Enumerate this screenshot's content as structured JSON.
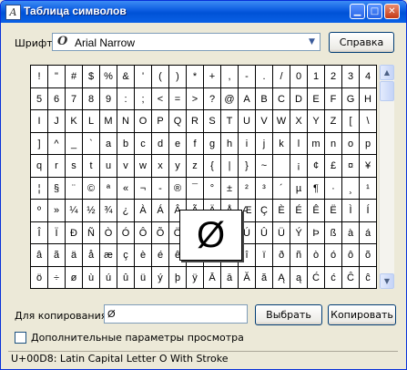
{
  "window": {
    "title": "Таблица символов"
  },
  "font": {
    "label": "Шрифт:",
    "value": "Arial Narrow"
  },
  "buttons": {
    "help": "Справка",
    "select": "Выбрать",
    "copy": "Копировать"
  },
  "copy": {
    "label": "Для копирования:",
    "value": "Ø"
  },
  "advanced": {
    "label": "Дополнительные параметры просмотра",
    "checked": false
  },
  "status": "U+00D8: Latin Capital Letter O With Stroke",
  "zoom": {
    "char": "Ø"
  },
  "icons": {
    "app": "char-map-icon",
    "minimize": "minimize-icon",
    "maximize": "maximize-icon",
    "close": "close-icon",
    "dropdown": "chevron-down-icon"
  },
  "grid": [
    [
      "!",
      "\"",
      "#",
      "$",
      "%",
      "&",
      "'",
      "(",
      ")",
      "*",
      "+",
      ",",
      "-",
      ".",
      "/",
      "0",
      "1",
      "2",
      "3",
      "4"
    ],
    [
      "5",
      "6",
      "7",
      "8",
      "9",
      ":",
      ";",
      "<",
      "=",
      ">",
      "?",
      "@",
      "A",
      "B",
      "C",
      "D",
      "E",
      "F",
      "G",
      "H"
    ],
    [
      "I",
      "J",
      "K",
      "L",
      "M",
      "N",
      "O",
      "P",
      "Q",
      "R",
      "S",
      "T",
      "U",
      "V",
      "W",
      "X",
      "Y",
      "Z",
      "[",
      "\\"
    ],
    [
      "]",
      "^",
      "_",
      "`",
      "a",
      "b",
      "c",
      "d",
      "e",
      "f",
      "g",
      "h",
      "i",
      "j",
      "k",
      "l",
      "m",
      "n",
      "o",
      "p"
    ],
    [
      "q",
      "r",
      "s",
      "t",
      "u",
      "v",
      "w",
      "x",
      "y",
      "z",
      "{",
      "|",
      "}",
      "~",
      " ",
      "¡",
      "¢",
      "£",
      "¤",
      "¥"
    ],
    [
      "¦",
      "§",
      "¨",
      "©",
      "ª",
      "«",
      "¬",
      "-",
      "®",
      "¯",
      "°",
      "±",
      "²",
      "³",
      "´",
      "µ",
      "¶",
      "·",
      "¸",
      "¹"
    ],
    [
      "º",
      "»",
      "¼",
      "½",
      "¾",
      "¿",
      "À",
      "Á",
      "Â",
      "Ã",
      "Ä",
      "Å",
      "Æ",
      "Ç",
      "È",
      "É",
      "Ê",
      "Ë",
      "Ì",
      "Í"
    ],
    [
      "Î",
      "Ï",
      "Ð",
      "Ñ",
      "Ò",
      "Ó",
      "Ô",
      "Õ",
      "Ö",
      "×",
      "Ø",
      "Ù",
      "Ú",
      "Û",
      "Ü",
      "Ý",
      "Þ",
      "ß",
      "à",
      "á"
    ],
    [
      "â",
      "ã",
      "ä",
      "å",
      "æ",
      "ç",
      "è",
      "é",
      "ê",
      "ë",
      "ì",
      "í",
      "î",
      "ï",
      "ð",
      "ñ",
      "ò",
      "ó",
      "ô",
      "õ"
    ],
    [
      "ö",
      "÷",
      "ø",
      "ù",
      "ú",
      "û",
      "ü",
      "ý",
      "þ",
      "ÿ",
      "Ā",
      "ā",
      "Ă",
      "ă",
      "Ą",
      "ą",
      "Ć",
      "ć",
      "Ĉ",
      "ĉ"
    ]
  ]
}
